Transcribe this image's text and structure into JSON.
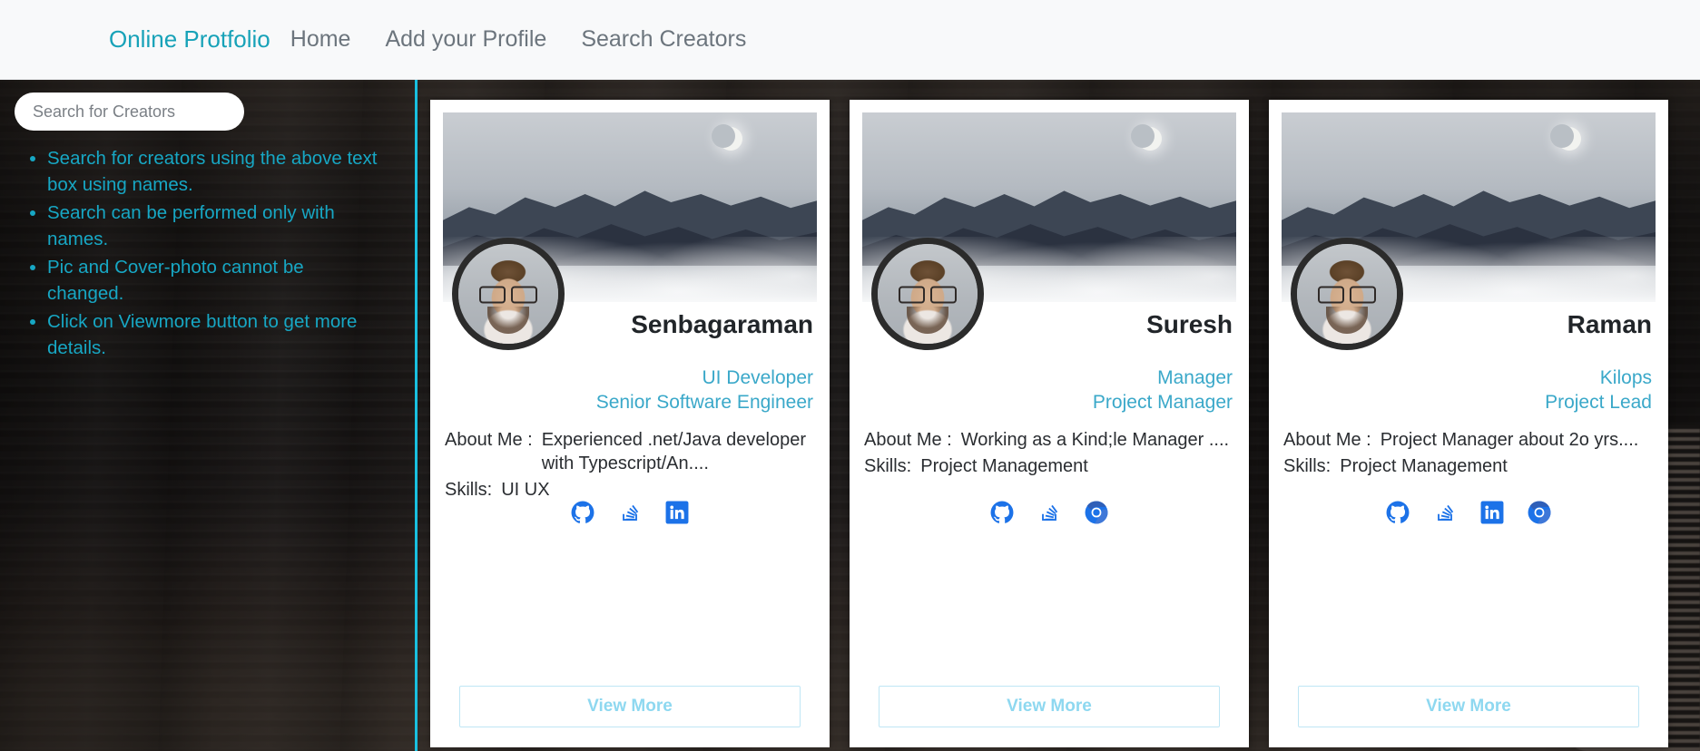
{
  "navbar": {
    "brand": "Online Protfolio",
    "links": [
      {
        "label": "Home"
      },
      {
        "label": "Add your Profile"
      },
      {
        "label": "Search Creators"
      }
    ]
  },
  "sidebar": {
    "search": {
      "placeholder": "Search for Creators",
      "value": ""
    },
    "tips": [
      {
        "text": "Search for creators using the above text box using names."
      },
      {
        "text": "Search can be performed only with names."
      },
      {
        "text": "Pic and Cover-photo cannot be changed."
      },
      {
        "text": "Click on Viewmore button to get more details."
      }
    ]
  },
  "labels": {
    "about": "About Me :",
    "skills": "Skills:",
    "view_more": "View More"
  },
  "colors": {
    "brand": "#17a2b8",
    "link": "#3aa8c9",
    "divider": "#19c0e0",
    "tip_text": "#17a7c4",
    "button_text": "#8ed8f0",
    "button_border": "#bfe6f5",
    "social_blue": "#1c72e8"
  },
  "cards": [
    {
      "name": "Senbagaraman",
      "role_primary": "UI Developer",
      "role_secondary": "Senior Software Engineer",
      "about": "Experienced .net/Java developer with Typescript/An....",
      "skills": "UI UX",
      "socials": [
        "github-icon",
        "stackoverflow-icon",
        "linkedin-icon"
      ],
      "view_more": "View More"
    },
    {
      "name": "Suresh",
      "role_primary": "Manager",
      "role_secondary": "Project Manager",
      "about": "Working as a Kind;le Manager ....",
      "skills": "Project Management",
      "socials": [
        "github-icon",
        "stackoverflow-icon",
        "chrome-icon"
      ],
      "view_more": "View More"
    },
    {
      "name": "Raman",
      "role_primary": "Kilops",
      "role_secondary": "Project Lead",
      "about": "Project Manager about 2o yrs....",
      "skills": "Project Management",
      "socials": [
        "github-icon",
        "stackoverflow-icon",
        "linkedin-icon",
        "chrome-icon"
      ],
      "view_more": "View More"
    }
  ]
}
